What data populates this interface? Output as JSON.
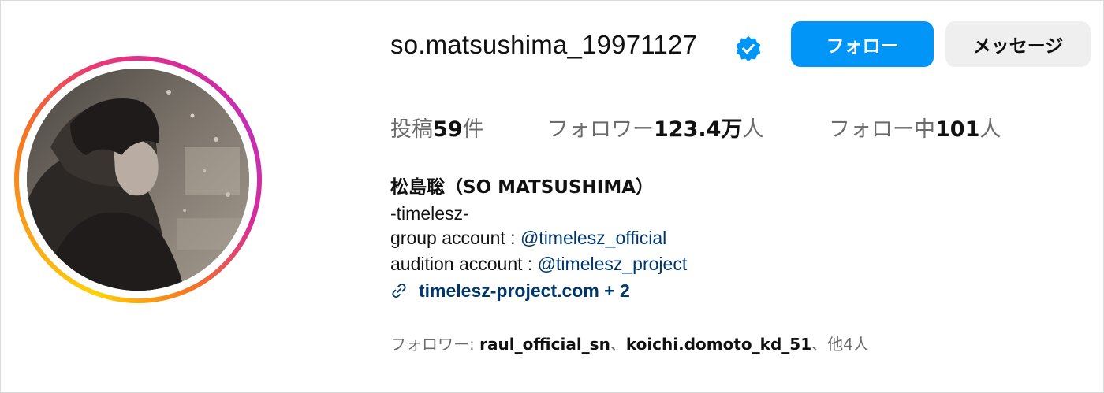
{
  "profile": {
    "username": "so.matsushima_19971127",
    "verified_icon": "verified-badge-icon",
    "follow_label": "フォロー",
    "message_label": "メッセージ",
    "colors": {
      "accent": "#0095f6",
      "link": "#00376b",
      "secondary_text": "#6b6b6b"
    }
  },
  "stats": {
    "posts_prefix": "投稿",
    "posts_count": "59",
    "posts_suffix": "件",
    "followers_prefix": "フォロワー",
    "followers_count": "123.4万",
    "followers_suffix": "人",
    "following_prefix": "フォロー中",
    "following_count": "101",
    "following_suffix": "人"
  },
  "bio": {
    "display_name": "松島聡（SO MATSUSHIMA）",
    "line1": "-timelesz-",
    "line2_prefix": "group account : ",
    "line2_mention": "@timelesz_official",
    "line3_prefix": "audition account : ",
    "line3_mention": "@timelesz_project",
    "link_icon": "link-icon",
    "link_text": "timelesz-project.com + 2"
  },
  "followed_by": {
    "prefix": "フォロワー: ",
    "user1": "raul_official_sn",
    "sep": "、",
    "user2": "koichi.domoto_kd_51",
    "suffix": "、他4人"
  }
}
